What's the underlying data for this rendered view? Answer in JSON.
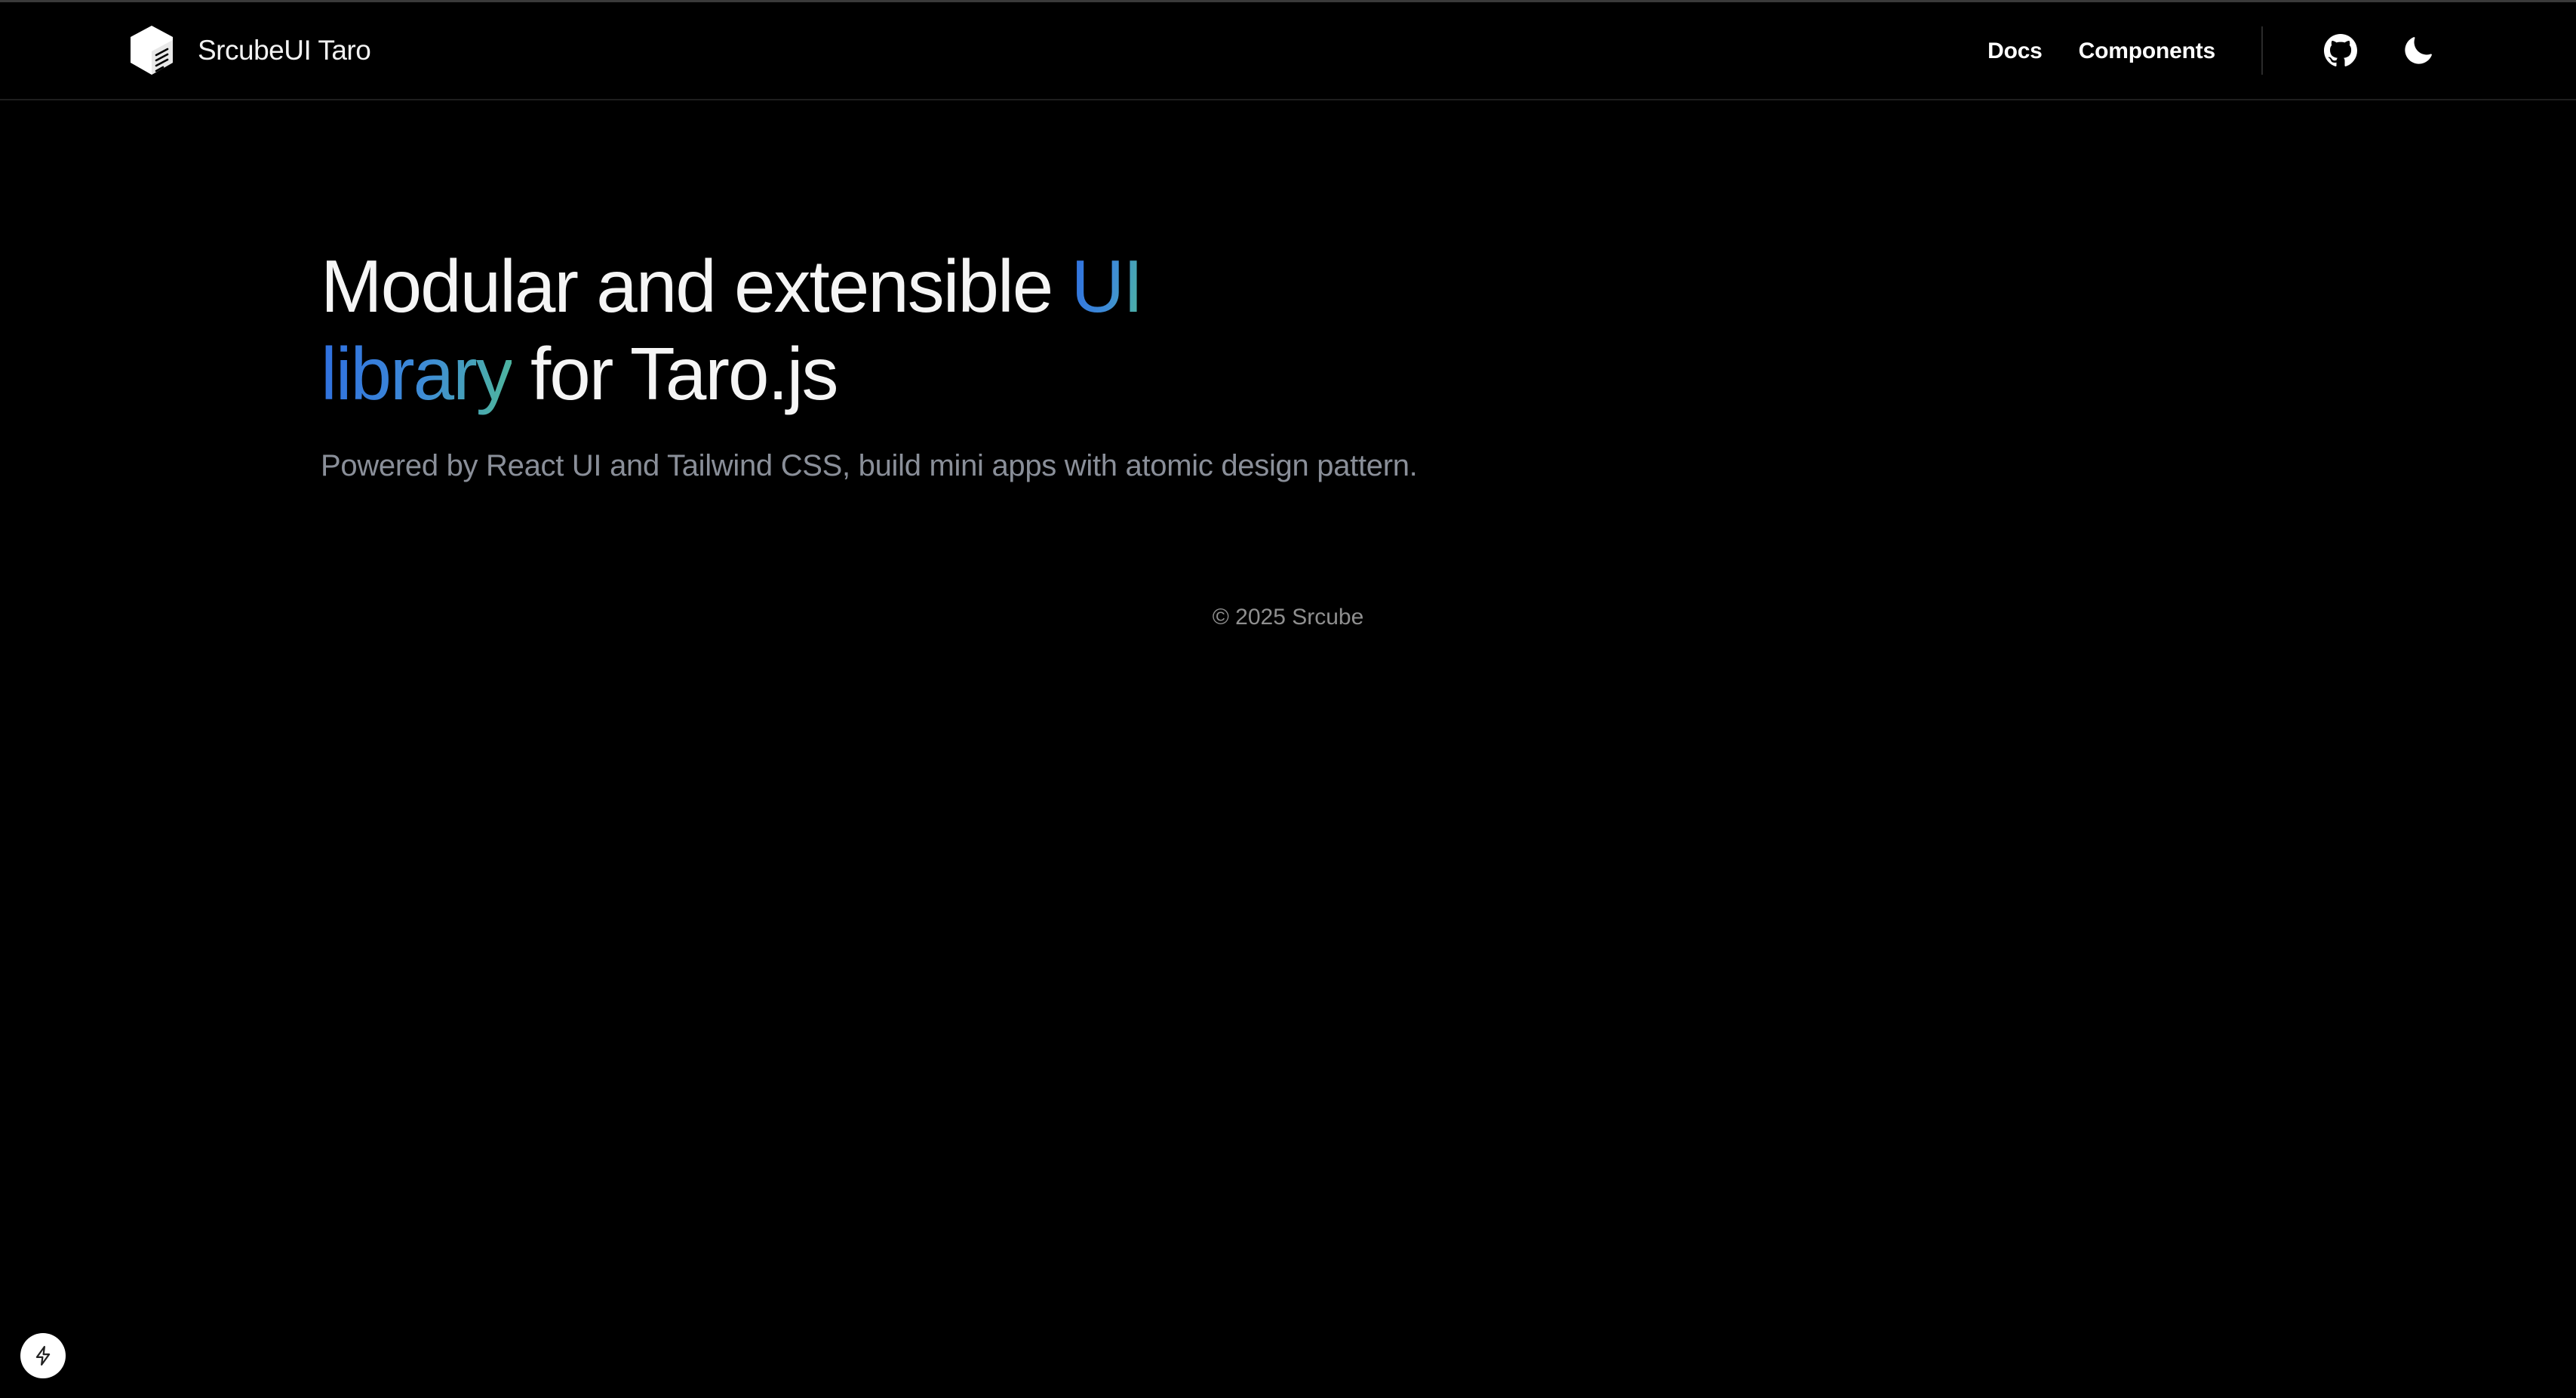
{
  "header": {
    "brand_name": "SrcubeUI Taro",
    "brand_icon": "cube-logo-icon",
    "nav": [
      {
        "label": "Docs"
      },
      {
        "label": "Components"
      }
    ],
    "github_icon": "github-icon",
    "theme_icon": "moon-icon"
  },
  "hero": {
    "title_part1": "Modular and extensible ",
    "title_highlight1": "UI",
    "title_highlight2": "library",
    "title_part2": " for Taro.js",
    "subtitle": "Powered by React UI and Tailwind CSS, build mini apps with atomic design pattern."
  },
  "footer": {
    "copyright": "© 2025 Srcube"
  },
  "dev_indicator": {
    "icon": "lightning-bolt-icon"
  },
  "colors": {
    "background": "#000000",
    "gradient_start": "#2f6fe0",
    "gradient_end": "#4fb89a",
    "subtitle": "#8a8f99"
  }
}
